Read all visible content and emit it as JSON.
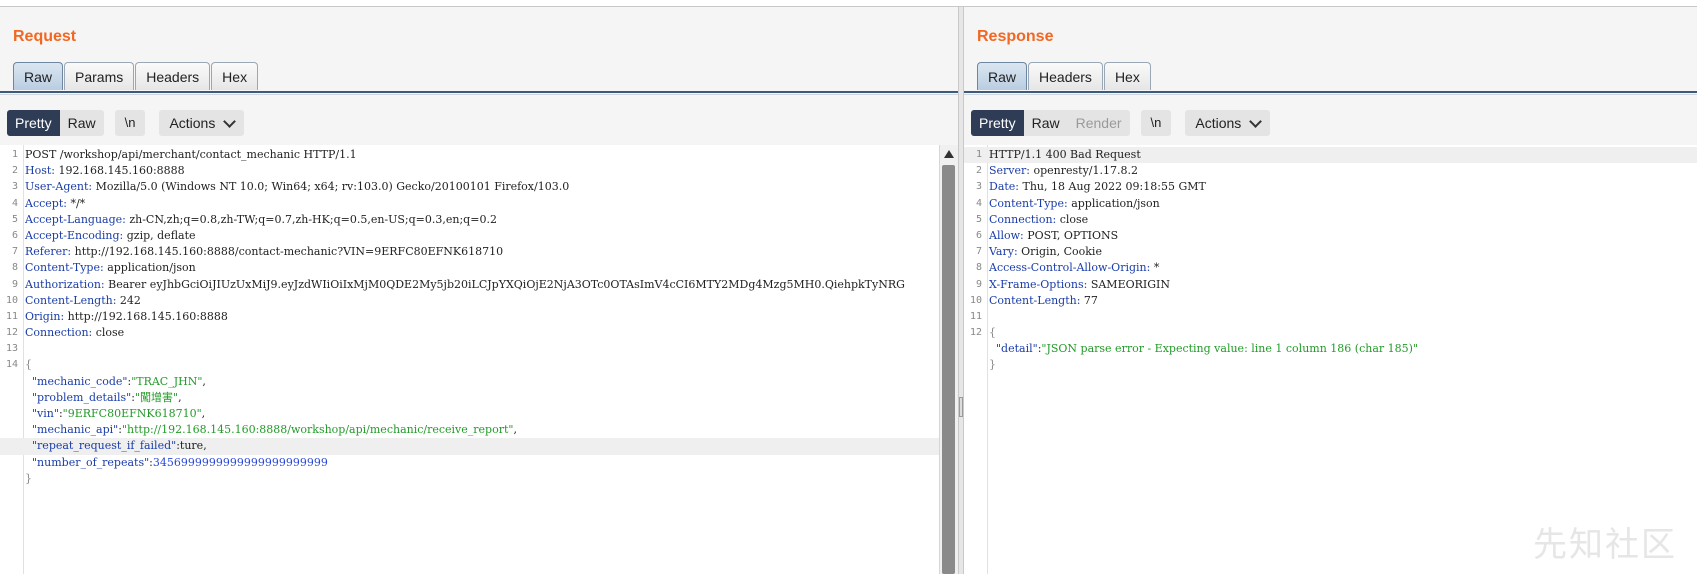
{
  "request": {
    "title": "Request",
    "tabs": [
      "Raw",
      "Params",
      "Headers",
      "Hex"
    ],
    "active_tab": "Raw",
    "toolbar": {
      "pretty": "Pretty",
      "raw": "Raw",
      "newline": "\\n",
      "actions": "Actions"
    },
    "lines": [
      {
        "n": "1",
        "plain": "POST /workshop/api/merchant/contact_mechanic HTTP/1.1"
      },
      {
        "n": "2",
        "name": "Host:",
        "value": " 192.168.145.160:8888"
      },
      {
        "n": "3",
        "name": "User-Agent:",
        "value": " Mozilla/5.0 (Windows NT 10.0; Win64; x64; rv:103.0) Gecko/20100101 Firefox/103.0"
      },
      {
        "n": "4",
        "name": "Accept:",
        "value": " */*"
      },
      {
        "n": "5",
        "name": "Accept-Language:",
        "value": " zh-CN,zh;q=0.8,zh-TW;q=0.7,zh-HK;q=0.5,en-US;q=0.3,en;q=0.2"
      },
      {
        "n": "6",
        "name": "Accept-Encoding:",
        "value": " gzip, deflate"
      },
      {
        "n": "7",
        "name": "Referer:",
        "value": " http://192.168.145.160:8888/contact-mechanic?VIN=9ERFC80EFNK618710"
      },
      {
        "n": "8",
        "name": "Content-Type:",
        "value": " application/json"
      },
      {
        "n": "9",
        "name": "Authorization:",
        "value": " Bearer eyJhbGciOiJIUzUxMiJ9.eyJzdWIiOiIxMjM0QDE2My5jb20iLCJpYXQiOjE2NjA3OTc0OTAsImV4cCI6MTY2MDg4Mzg5MH0.QiehpkTyNRG"
      },
      {
        "n": "10",
        "name": "Content-Length:",
        "value": " 242"
      },
      {
        "n": "11",
        "name": "Origin:",
        "value": " http://192.168.145.160:8888"
      },
      {
        "n": "12",
        "name": "Connection:",
        "value": " close"
      },
      {
        "n": "13",
        "plain": ""
      },
      {
        "n": "14",
        "brace": "{"
      },
      {
        "n": "",
        "key": "  \"mechanic_code\"",
        "str": "\"TRAC_JHN\"",
        "tail": ","
      },
      {
        "n": "",
        "key": "  \"problem_details\"",
        "str": "\"闖增害\"",
        "tail": ","
      },
      {
        "n": "",
        "key": "  \"vin\"",
        "str": "\"9ERFC80EFNK618710\"",
        "tail": ","
      },
      {
        "n": "",
        "key": "  \"mechanic_api\"",
        "str": "\"http://192.168.145.160:8888/workshop/api/mechanic/receive_report\"",
        "tail": ","
      },
      {
        "n": "",
        "key": "  \"repeat_request_if_failed\"",
        "raw": "ture",
        "tail": ",",
        "highlight": true
      },
      {
        "n": "",
        "key": "  \"number_of_repeats\"",
        "num": "3456999999999999999999999"
      },
      {
        "n": "",
        "brace": "}"
      }
    ]
  },
  "response": {
    "title": "Response",
    "tabs": [
      "Raw",
      "Headers",
      "Hex"
    ],
    "active_tab": "Raw",
    "toolbar": {
      "pretty": "Pretty",
      "raw": "Raw",
      "render": "Render",
      "newline": "\\n",
      "actions": "Actions"
    },
    "lines": [
      {
        "n": "1",
        "plain": "HTTP/1.1 400 Bad Request",
        "highlight": true
      },
      {
        "n": "2",
        "name": "Server:",
        "value": " openresty/1.17.8.2"
      },
      {
        "n": "3",
        "name": "Date:",
        "value": " Thu, 18 Aug 2022 09:18:55 GMT"
      },
      {
        "n": "4",
        "name": "Content-Type:",
        "value": " application/json"
      },
      {
        "n": "5",
        "name": "Connection:",
        "value": " close"
      },
      {
        "n": "6",
        "name": "Allow:",
        "value": " POST, OPTIONS"
      },
      {
        "n": "7",
        "name": "Vary:",
        "value": " Origin, Cookie"
      },
      {
        "n": "8",
        "name": "Access-Control-Allow-Origin:",
        "value": " *"
      },
      {
        "n": "9",
        "name": "X-Frame-Options:",
        "value": " SAMEORIGIN"
      },
      {
        "n": "10",
        "name": "Content-Length:",
        "value": " 77"
      },
      {
        "n": "11",
        "plain": ""
      },
      {
        "n": "12",
        "brace": "{"
      },
      {
        "n": "",
        "key": "  \"detail\"",
        "str": "\"JSON parse error - Expecting value: line 1 column 186 (char 185)\""
      },
      {
        "n": "",
        "brace": "}"
      }
    ]
  },
  "watermark": "先知社区"
}
